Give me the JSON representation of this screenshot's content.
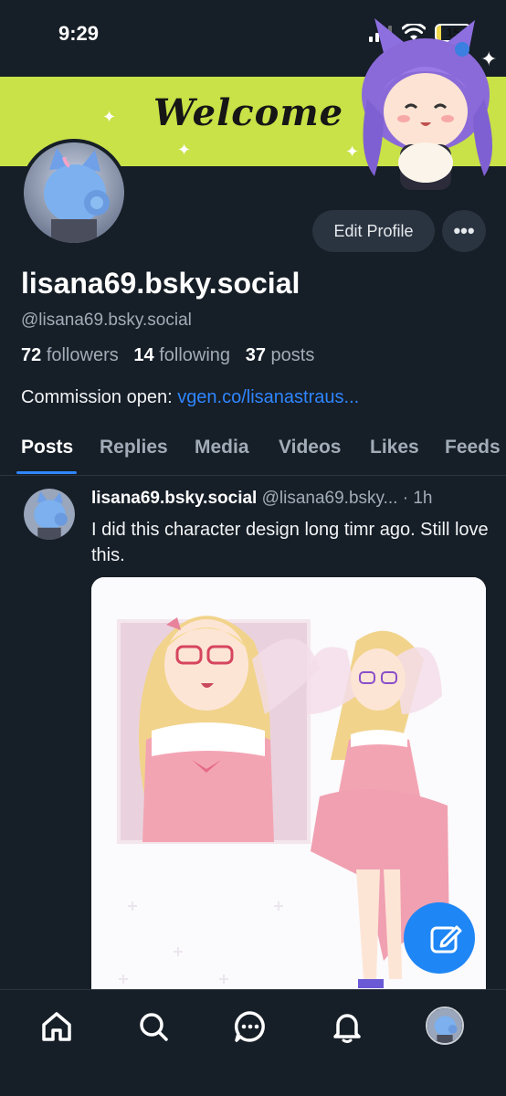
{
  "status_bar": {
    "time": "9:29",
    "battery": "15",
    "battery_level": 0.15
  },
  "banner": {
    "welcome_text": "Welcome"
  },
  "profile": {
    "edit_label": "Edit Profile",
    "more_label": "•••",
    "display_name": "lisana69.bsky.social",
    "handle": "@lisana69.bsky.social",
    "followers_count": "72",
    "followers_label": "followers",
    "following_count": "14",
    "following_label": "following",
    "posts_count": "37",
    "posts_label": "posts",
    "bio_text": "Commission open: ",
    "bio_link": "vgen.co/lisanastraus..."
  },
  "tabs": [
    {
      "label": "Posts",
      "active": true
    },
    {
      "label": "Replies"
    },
    {
      "label": "Media"
    },
    {
      "label": "Videos"
    },
    {
      "label": "Likes"
    },
    {
      "label": "Feeds"
    }
  ],
  "post": {
    "author_name": "lisana69.bsky.social",
    "author_handle": "@lisana69.bsky...",
    "time": " · 1h",
    "text": "I did this character design long timr ago. Still love this."
  },
  "nav": [
    "home-icon",
    "search-icon",
    "chat-icon",
    "bell-icon",
    "profile-avatar"
  ],
  "colors": {
    "accent": "#2f86ff",
    "banner": "#c8e247",
    "background": "#161e27"
  }
}
